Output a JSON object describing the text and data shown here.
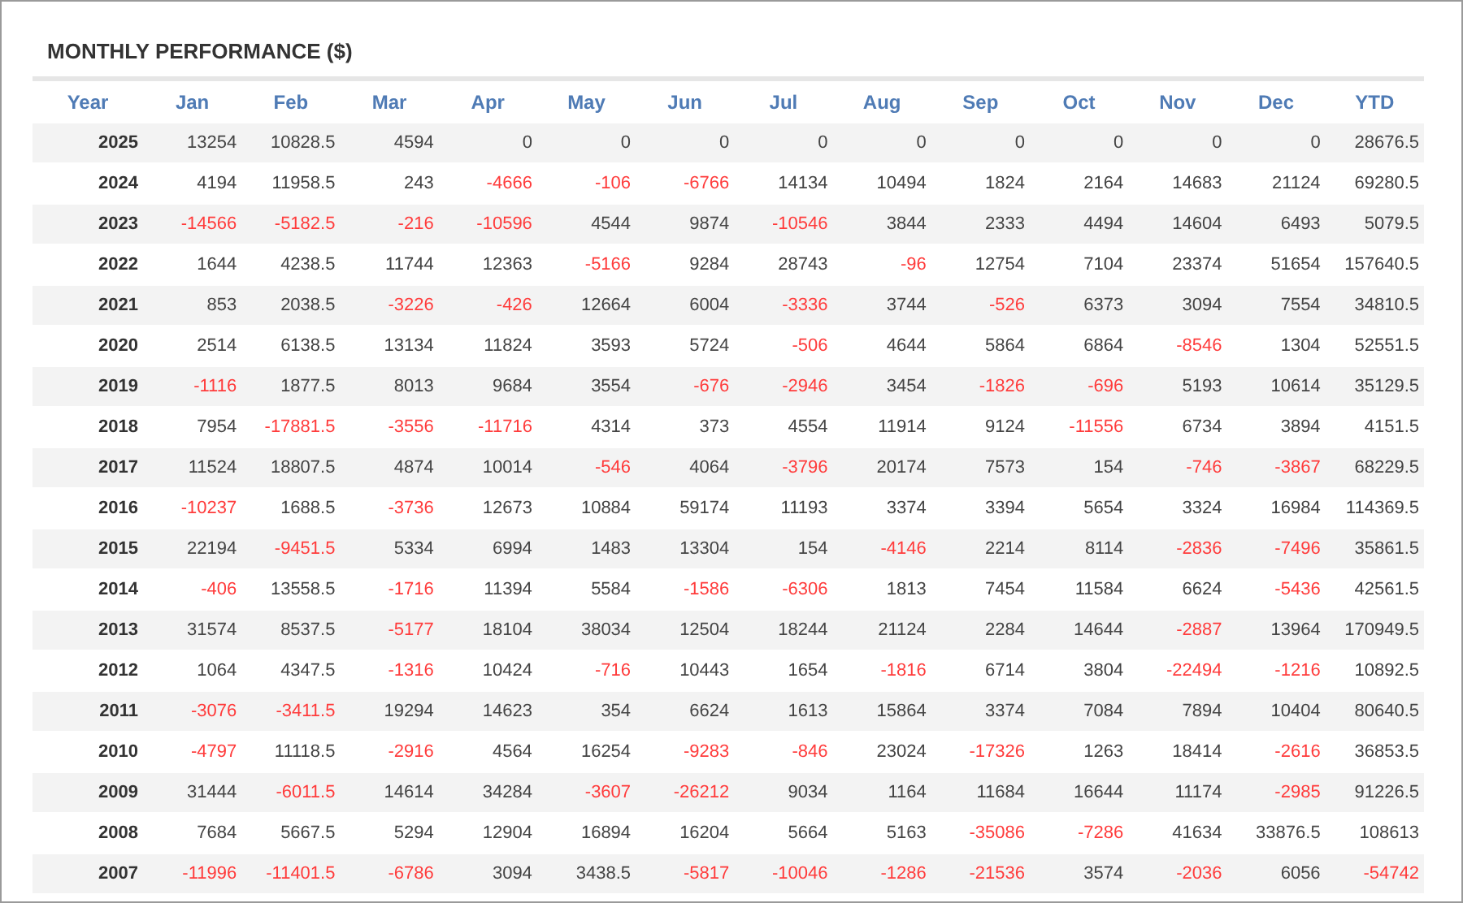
{
  "title": "MONTHLY PERFORMANCE ($)",
  "columns": [
    "Year",
    "Jan",
    "Feb",
    "Mar",
    "Apr",
    "May",
    "Jun",
    "Jul",
    "Aug",
    "Sep",
    "Oct",
    "Nov",
    "Dec",
    "YTD"
  ],
  "rows": [
    {
      "year": "2025",
      "cells": [
        {
          "text": "13254",
          "negative": false
        },
        {
          "text": "10828.5",
          "negative": false
        },
        {
          "text": "4594",
          "negative": false
        },
        {
          "text": "0",
          "negative": false
        },
        {
          "text": "0",
          "negative": false
        },
        {
          "text": "0",
          "negative": false
        },
        {
          "text": "0",
          "negative": false
        },
        {
          "text": "0",
          "negative": false
        },
        {
          "text": "0",
          "negative": false
        },
        {
          "text": "0",
          "negative": false
        },
        {
          "text": "0",
          "negative": false
        },
        {
          "text": "0",
          "negative": false
        },
        {
          "text": "28676.5",
          "negative": false
        }
      ]
    },
    {
      "year": "2024",
      "cells": [
        {
          "text": "4194",
          "negative": false
        },
        {
          "text": "11958.5",
          "negative": false
        },
        {
          "text": "243",
          "negative": false
        },
        {
          "text": "-4666",
          "negative": true
        },
        {
          "text": "-106",
          "negative": true
        },
        {
          "text": "-6766",
          "negative": true
        },
        {
          "text": "14134",
          "negative": false
        },
        {
          "text": "10494",
          "negative": false
        },
        {
          "text": "1824",
          "negative": false
        },
        {
          "text": "2164",
          "negative": false
        },
        {
          "text": "14683",
          "negative": false
        },
        {
          "text": "21124",
          "negative": false
        },
        {
          "text": "69280.5",
          "negative": false
        }
      ]
    },
    {
      "year": "2023",
      "cells": [
        {
          "text": "-14566",
          "negative": true
        },
        {
          "text": "-5182.5",
          "negative": true
        },
        {
          "text": "-216",
          "negative": true
        },
        {
          "text": "-10596",
          "negative": true
        },
        {
          "text": "4544",
          "negative": false
        },
        {
          "text": "9874",
          "negative": false
        },
        {
          "text": "-10546",
          "negative": true
        },
        {
          "text": "3844",
          "negative": false
        },
        {
          "text": "2333",
          "negative": false
        },
        {
          "text": "4494",
          "negative": false
        },
        {
          "text": "14604",
          "negative": false
        },
        {
          "text": "6493",
          "negative": false
        },
        {
          "text": "5079.5",
          "negative": false
        }
      ]
    },
    {
      "year": "2022",
      "cells": [
        {
          "text": "1644",
          "negative": false
        },
        {
          "text": "4238.5",
          "negative": false
        },
        {
          "text": "11744",
          "negative": false
        },
        {
          "text": "12363",
          "negative": false
        },
        {
          "text": "-5166",
          "negative": true
        },
        {
          "text": "9284",
          "negative": false
        },
        {
          "text": "28743",
          "negative": false
        },
        {
          "text": "-96",
          "negative": true
        },
        {
          "text": "12754",
          "negative": false
        },
        {
          "text": "7104",
          "negative": false
        },
        {
          "text": "23374",
          "negative": false
        },
        {
          "text": "51654",
          "negative": false
        },
        {
          "text": "157640.5",
          "negative": false
        }
      ]
    },
    {
      "year": "2021",
      "cells": [
        {
          "text": "853",
          "negative": false
        },
        {
          "text": "2038.5",
          "negative": false
        },
        {
          "text": "-3226",
          "negative": true
        },
        {
          "text": "-426",
          "negative": true
        },
        {
          "text": "12664",
          "negative": false
        },
        {
          "text": "6004",
          "negative": false
        },
        {
          "text": "-3336",
          "negative": true
        },
        {
          "text": "3744",
          "negative": false
        },
        {
          "text": "-526",
          "negative": true
        },
        {
          "text": "6373",
          "negative": false
        },
        {
          "text": "3094",
          "negative": false
        },
        {
          "text": "7554",
          "negative": false
        },
        {
          "text": "34810.5",
          "negative": false
        }
      ]
    },
    {
      "year": "2020",
      "cells": [
        {
          "text": "2514",
          "negative": false
        },
        {
          "text": "6138.5",
          "negative": false
        },
        {
          "text": "13134",
          "negative": false
        },
        {
          "text": "11824",
          "negative": false
        },
        {
          "text": "3593",
          "negative": false
        },
        {
          "text": "5724",
          "negative": false
        },
        {
          "text": "-506",
          "negative": true
        },
        {
          "text": "4644",
          "negative": false
        },
        {
          "text": "5864",
          "negative": false
        },
        {
          "text": "6864",
          "negative": false
        },
        {
          "text": "-8546",
          "negative": true
        },
        {
          "text": "1304",
          "negative": false
        },
        {
          "text": "52551.5",
          "negative": false
        }
      ]
    },
    {
      "year": "2019",
      "cells": [
        {
          "text": "-1116",
          "negative": true
        },
        {
          "text": "1877.5",
          "negative": false
        },
        {
          "text": "8013",
          "negative": false
        },
        {
          "text": "9684",
          "negative": false
        },
        {
          "text": "3554",
          "negative": false
        },
        {
          "text": "-676",
          "negative": true
        },
        {
          "text": "-2946",
          "negative": true
        },
        {
          "text": "3454",
          "negative": false
        },
        {
          "text": "-1826",
          "negative": true
        },
        {
          "text": "-696",
          "negative": true
        },
        {
          "text": "5193",
          "negative": false
        },
        {
          "text": "10614",
          "negative": false
        },
        {
          "text": "35129.5",
          "negative": false
        }
      ]
    },
    {
      "year": "2018",
      "cells": [
        {
          "text": "7954",
          "negative": false
        },
        {
          "text": "-17881.5",
          "negative": true
        },
        {
          "text": "-3556",
          "negative": true
        },
        {
          "text": "-11716",
          "negative": true
        },
        {
          "text": "4314",
          "negative": false
        },
        {
          "text": "373",
          "negative": false
        },
        {
          "text": "4554",
          "negative": false
        },
        {
          "text": "11914",
          "negative": false
        },
        {
          "text": "9124",
          "negative": false
        },
        {
          "text": "-11556",
          "negative": true
        },
        {
          "text": "6734",
          "negative": false
        },
        {
          "text": "3894",
          "negative": false
        },
        {
          "text": "4151.5",
          "negative": false
        }
      ]
    },
    {
      "year": "2017",
      "cells": [
        {
          "text": "11524",
          "negative": false
        },
        {
          "text": "18807.5",
          "negative": false
        },
        {
          "text": "4874",
          "negative": false
        },
        {
          "text": "10014",
          "negative": false
        },
        {
          "text": "-546",
          "negative": true
        },
        {
          "text": "4064",
          "negative": false
        },
        {
          "text": "-3796",
          "negative": true
        },
        {
          "text": "20174",
          "negative": false
        },
        {
          "text": "7573",
          "negative": false
        },
        {
          "text": "154",
          "negative": false
        },
        {
          "text": "-746",
          "negative": true
        },
        {
          "text": "-3867",
          "negative": true
        },
        {
          "text": "68229.5",
          "negative": false
        }
      ]
    },
    {
      "year": "2016",
      "cells": [
        {
          "text": "-10237",
          "negative": true
        },
        {
          "text": "1688.5",
          "negative": false
        },
        {
          "text": "-3736",
          "negative": true
        },
        {
          "text": "12673",
          "negative": false
        },
        {
          "text": "10884",
          "negative": false
        },
        {
          "text": "59174",
          "negative": false
        },
        {
          "text": "11193",
          "negative": false
        },
        {
          "text": "3374",
          "negative": false
        },
        {
          "text": "3394",
          "negative": false
        },
        {
          "text": "5654",
          "negative": false
        },
        {
          "text": "3324",
          "negative": false
        },
        {
          "text": "16984",
          "negative": false
        },
        {
          "text": "114369.5",
          "negative": false
        }
      ]
    },
    {
      "year": "2015",
      "cells": [
        {
          "text": "22194",
          "negative": false
        },
        {
          "text": "-9451.5",
          "negative": true
        },
        {
          "text": "5334",
          "negative": false
        },
        {
          "text": "6994",
          "negative": false
        },
        {
          "text": "1483",
          "negative": false
        },
        {
          "text": "13304",
          "negative": false
        },
        {
          "text": "154",
          "negative": false
        },
        {
          "text": "-4146",
          "negative": true
        },
        {
          "text": "2214",
          "negative": false
        },
        {
          "text": "8114",
          "negative": false
        },
        {
          "text": "-2836",
          "negative": true
        },
        {
          "text": "-7496",
          "negative": true
        },
        {
          "text": "35861.5",
          "negative": false
        }
      ]
    },
    {
      "year": "2014",
      "cells": [
        {
          "text": "-406",
          "negative": true
        },
        {
          "text": "13558.5",
          "negative": false
        },
        {
          "text": "-1716",
          "negative": true
        },
        {
          "text": "11394",
          "negative": false
        },
        {
          "text": "5584",
          "negative": false
        },
        {
          "text": "-1586",
          "negative": true
        },
        {
          "text": "-6306",
          "negative": true
        },
        {
          "text": "1813",
          "negative": false
        },
        {
          "text": "7454",
          "negative": false
        },
        {
          "text": "11584",
          "negative": false
        },
        {
          "text": "6624",
          "negative": false
        },
        {
          "text": "-5436",
          "negative": true
        },
        {
          "text": "42561.5",
          "negative": false
        }
      ]
    },
    {
      "year": "2013",
      "cells": [
        {
          "text": "31574",
          "negative": false
        },
        {
          "text": "8537.5",
          "negative": false
        },
        {
          "text": "-5177",
          "negative": true
        },
        {
          "text": "18104",
          "negative": false
        },
        {
          "text": "38034",
          "negative": false
        },
        {
          "text": "12504",
          "negative": false
        },
        {
          "text": "18244",
          "negative": false
        },
        {
          "text": "21124",
          "negative": false
        },
        {
          "text": "2284",
          "negative": false
        },
        {
          "text": "14644",
          "negative": false
        },
        {
          "text": "-2887",
          "negative": true
        },
        {
          "text": "13964",
          "negative": false
        },
        {
          "text": "170949.5",
          "negative": false
        }
      ]
    },
    {
      "year": "2012",
      "cells": [
        {
          "text": "1064",
          "negative": false
        },
        {
          "text": "4347.5",
          "negative": false
        },
        {
          "text": "-1316",
          "negative": true
        },
        {
          "text": "10424",
          "negative": false
        },
        {
          "text": "-716",
          "negative": true
        },
        {
          "text": "10443",
          "negative": false
        },
        {
          "text": "1654",
          "negative": false
        },
        {
          "text": "-1816",
          "negative": true
        },
        {
          "text": "6714",
          "negative": false
        },
        {
          "text": "3804",
          "negative": false
        },
        {
          "text": "-22494",
          "negative": true
        },
        {
          "text": "-1216",
          "negative": true
        },
        {
          "text": "10892.5",
          "negative": false
        }
      ]
    },
    {
      "year": "2011",
      "cells": [
        {
          "text": "-3076",
          "negative": true
        },
        {
          "text": "-3411.5",
          "negative": true
        },
        {
          "text": "19294",
          "negative": false
        },
        {
          "text": "14623",
          "negative": false
        },
        {
          "text": "354",
          "negative": false
        },
        {
          "text": "6624",
          "negative": false
        },
        {
          "text": "1613",
          "negative": false
        },
        {
          "text": "15864",
          "negative": false
        },
        {
          "text": "3374",
          "negative": false
        },
        {
          "text": "7084",
          "negative": false
        },
        {
          "text": "7894",
          "negative": false
        },
        {
          "text": "10404",
          "negative": false
        },
        {
          "text": "80640.5",
          "negative": false
        }
      ]
    },
    {
      "year": "2010",
      "cells": [
        {
          "text": "-4797",
          "negative": true
        },
        {
          "text": "11118.5",
          "negative": false
        },
        {
          "text": "-2916",
          "negative": true
        },
        {
          "text": "4564",
          "negative": false
        },
        {
          "text": "16254",
          "negative": false
        },
        {
          "text": "-9283",
          "negative": true
        },
        {
          "text": "-846",
          "negative": true
        },
        {
          "text": "23024",
          "negative": false
        },
        {
          "text": "-17326",
          "negative": true
        },
        {
          "text": "1263",
          "negative": false
        },
        {
          "text": "18414",
          "negative": false
        },
        {
          "text": "-2616",
          "negative": true
        },
        {
          "text": "36853.5",
          "negative": false
        }
      ]
    },
    {
      "year": "2009",
      "cells": [
        {
          "text": "31444",
          "negative": false
        },
        {
          "text": "-6011.5",
          "negative": true
        },
        {
          "text": "14614",
          "negative": false
        },
        {
          "text": "34284",
          "negative": false
        },
        {
          "text": "-3607",
          "negative": true
        },
        {
          "text": "-26212",
          "negative": true
        },
        {
          "text": "9034",
          "negative": false
        },
        {
          "text": "1164",
          "negative": false
        },
        {
          "text": "11684",
          "negative": false
        },
        {
          "text": "16644",
          "negative": false
        },
        {
          "text": "11174",
          "negative": false
        },
        {
          "text": "-2985",
          "negative": true
        },
        {
          "text": "91226.5",
          "negative": false
        }
      ]
    },
    {
      "year": "2008",
      "cells": [
        {
          "text": "7684",
          "negative": false
        },
        {
          "text": "5667.5",
          "negative": false
        },
        {
          "text": "5294",
          "negative": false
        },
        {
          "text": "12904",
          "negative": false
        },
        {
          "text": "16894",
          "negative": false
        },
        {
          "text": "16204",
          "negative": false
        },
        {
          "text": "5664",
          "negative": false
        },
        {
          "text": "5163",
          "negative": false
        },
        {
          "text": "-35086",
          "negative": true
        },
        {
          "text": "-7286",
          "negative": true
        },
        {
          "text": "41634",
          "negative": false
        },
        {
          "text": "33876.5",
          "negative": false
        },
        {
          "text": "108613",
          "negative": false
        }
      ]
    },
    {
      "year": "2007",
      "cells": [
        {
          "text": "-11996",
          "negative": true
        },
        {
          "text": "-11401.5",
          "negative": true
        },
        {
          "text": "-6786",
          "negative": true
        },
        {
          "text": "3094",
          "negative": false
        },
        {
          "text": "3438.5",
          "negative": false
        },
        {
          "text": "-5817",
          "negative": true
        },
        {
          "text": "-10046",
          "negative": true
        },
        {
          "text": "-1286",
          "negative": true
        },
        {
          "text": "-21536",
          "negative": true
        },
        {
          "text": "3574",
          "negative": false
        },
        {
          "text": "-2036",
          "negative": true
        },
        {
          "text": "6056",
          "negative": false
        },
        {
          "text": "-54742",
          "negative": true
        }
      ]
    }
  ]
}
